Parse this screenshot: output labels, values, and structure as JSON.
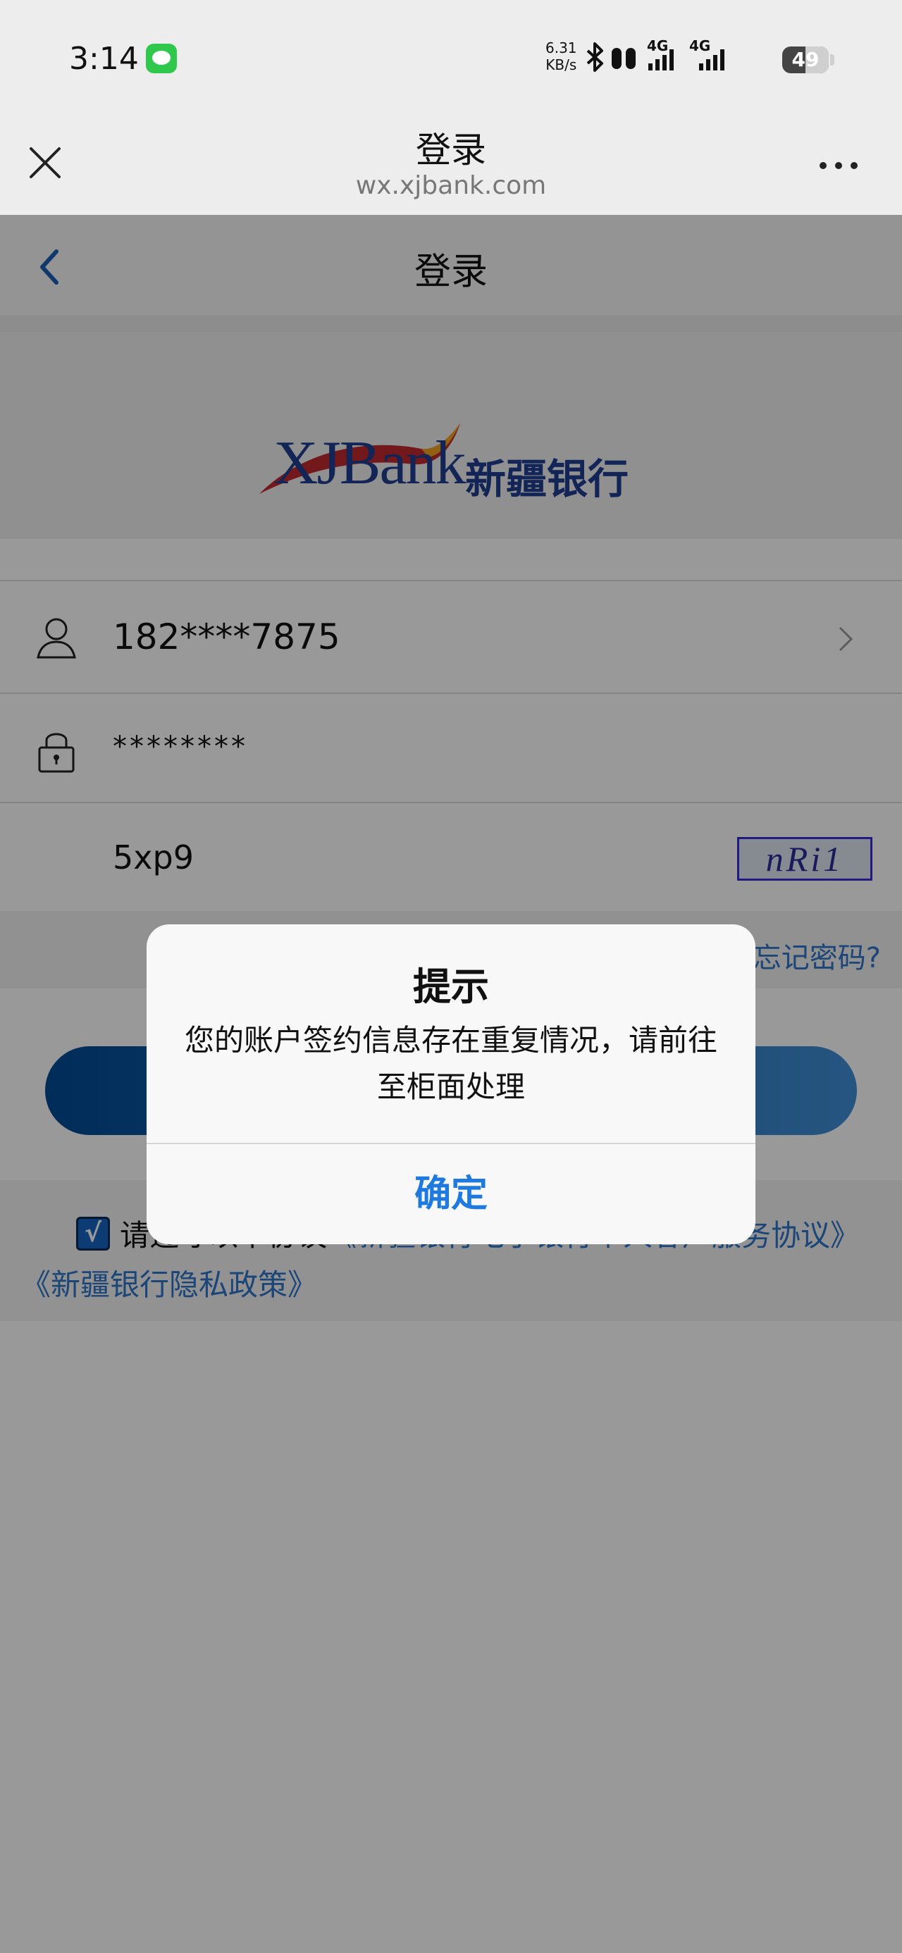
{
  "status_bar": {
    "time": "3:14",
    "speed_value": "6.31",
    "speed_unit": "KB/s",
    "network_1": "4G",
    "network_2": "4G",
    "battery": "49"
  },
  "browser": {
    "title": "登录",
    "url": "wx.xjbank.com"
  },
  "page": {
    "nav_title": "登录",
    "logo_text": "XJBank",
    "logo_cn": "新疆银行",
    "username": "182****7875",
    "password_masked": "********",
    "captcha_input": "5xp9",
    "captcha_image_text": "nRi1",
    "forgot_password": "忘记密码?",
    "agreement_prefix": "请遵守以下协议",
    "agreement_link_1": "《新疆银行电子银行个人客户服务协议》",
    "agreement_link_2": "《新疆银行隐私政策》"
  },
  "dialog": {
    "title": "提示",
    "message": "您的账户签约信息存在重复情况，请前往至柜面处理",
    "confirm": "确定"
  },
  "colors": {
    "accent_blue": "#1f7ae0",
    "brand_navy": "#1e3f8f",
    "message_green": "#2fc84d"
  }
}
